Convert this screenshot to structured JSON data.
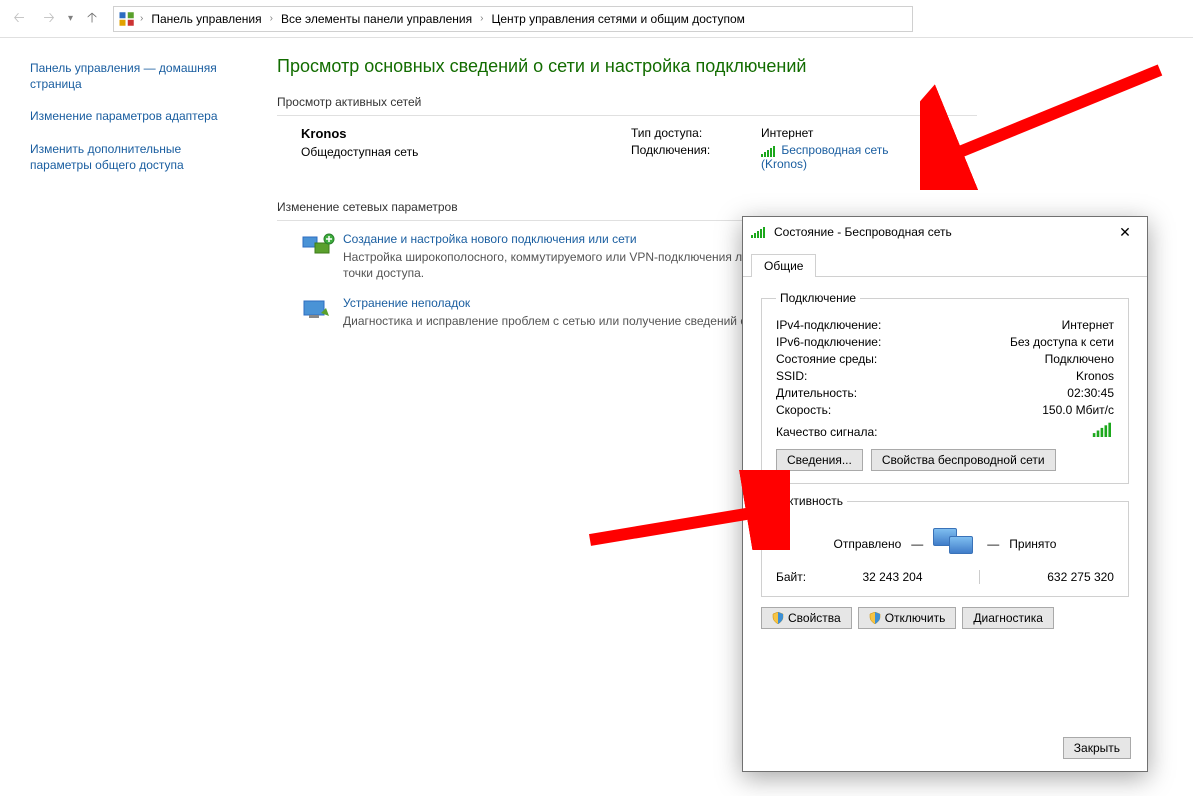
{
  "breadcrumb": {
    "seg1": "Панель управления",
    "seg2": "Все элементы панели управления",
    "seg3": "Центр управления сетями и общим доступом"
  },
  "sidebar": {
    "link1": "Панель управления — домашняя страница",
    "link2": "Изменение параметров адаптера",
    "link3": "Изменить дополнительные параметры общего доступа"
  },
  "main": {
    "heading": "Просмотр основных сведений о сети и настройка подключений",
    "sec_active_title": "Просмотр активных сетей",
    "network_name": "Kronos",
    "network_type": "Общедоступная сеть",
    "access_label": "Тип доступа:",
    "access_value": "Интернет",
    "conn_label": "Подключения:",
    "conn_value_line1": "Беспроводная сеть",
    "conn_value_line2": "(Kronos)",
    "sec_change_title": "Изменение сетевых параметров",
    "act1_title": "Создание и настройка нового подключения или сети",
    "act1_desc": "Настройка широкополосного, коммутируемого или VPN-подключения либо настройка маршрутизатора или точки доступа.",
    "act2_title": "Устранение неполадок",
    "act2_desc": "Диагностика и исправление проблем с сетью или получение сведений об устранении неполадок."
  },
  "dialog": {
    "title": "Состояние - Беспроводная сеть",
    "tab": "Общие",
    "fs_connection": "Подключение",
    "r_ipv4_k": "IPv4-подключение:",
    "r_ipv4_v": "Интернет",
    "r_ipv6_k": "IPv6-подключение:",
    "r_ipv6_v": "Без доступа к сети",
    "r_media_k": "Состояние среды:",
    "r_media_v": "Подключено",
    "r_ssid_k": "SSID:",
    "r_ssid_v": "Kronos",
    "r_dur_k": "Длительность:",
    "r_dur_v": "02:30:45",
    "r_speed_k": "Скорость:",
    "r_speed_v": "150.0 Мбит/с",
    "r_sig_k": "Качество сигнала:",
    "btn_details": "Сведения...",
    "btn_wprops": "Свойства беспроводной сети",
    "fs_activity": "Активность",
    "act_sent": "Отправлено",
    "act_recv": "Принято",
    "bytes_label": "Байт:",
    "bytes_sent": "32 243 204",
    "bytes_recv": "632 275 320",
    "btn_props": "Свойства",
    "btn_disable": "Отключить",
    "btn_diag": "Диагностика",
    "btn_close": "Закрыть"
  }
}
